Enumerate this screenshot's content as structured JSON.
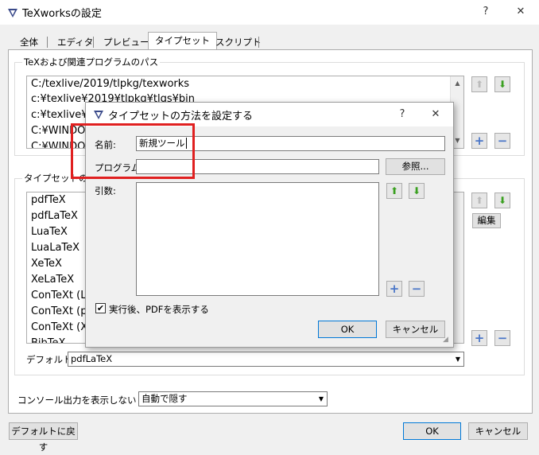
{
  "window": {
    "title": "TeXworksの設定",
    "help_label": "?",
    "close_label": "✕"
  },
  "tabs": [
    {
      "label": "全体"
    },
    {
      "label": "エディタ"
    },
    {
      "label": "プレビュー"
    },
    {
      "label": "タイプセット"
    },
    {
      "label": "スクリプト"
    }
  ],
  "paths_group": {
    "label": "TeXおよび関連プログラムのパス",
    "items": [
      "C:/texlive/2019/tlpkg/texworks",
      "c:¥texlive¥2019¥tlpkg¥tlgs¥bin",
      "c:¥texlive¥",
      "C:¥WINDO",
      "C:¥WINDO"
    ]
  },
  "typeset_group": {
    "label": "タイプセットの方",
    "items": [
      "pdfTeX",
      "pdfLaTeX",
      "LuaTeX",
      "LuaLaTeX",
      "XeTeX",
      "XeLaTeX",
      "ConTeXt (L",
      "ConTeXt (p",
      "ConTeXt (X",
      "BibTeX"
    ],
    "edit_label": "編集",
    "default_label": "デフォルト:",
    "default_value": "pdfLaTeX"
  },
  "console": {
    "label": "コンソール出力を表示しない",
    "value": "自動で隠す"
  },
  "footer": {
    "reset_label": "デフォルトに戻す",
    "ok_label": "OK",
    "cancel_label": "キャンセル"
  },
  "dialog": {
    "title": "タイプセットの方法を設定する",
    "help_label": "?",
    "close_label": "✕",
    "name_label": "名前:",
    "name_value": "新規ツール",
    "program_label": "プログラム:",
    "program_value": "",
    "browse_label": "参照...",
    "args_label": "引数:",
    "show_pdf_label": "実行後、PDFを表示する",
    "show_pdf_checked": true,
    "ok_label": "OK",
    "cancel_label": "キャンセル"
  },
  "colors": {
    "highlight_box": "#e02020",
    "arrow_active": "#3aa020",
    "plus_minus": "#4a76c8"
  }
}
